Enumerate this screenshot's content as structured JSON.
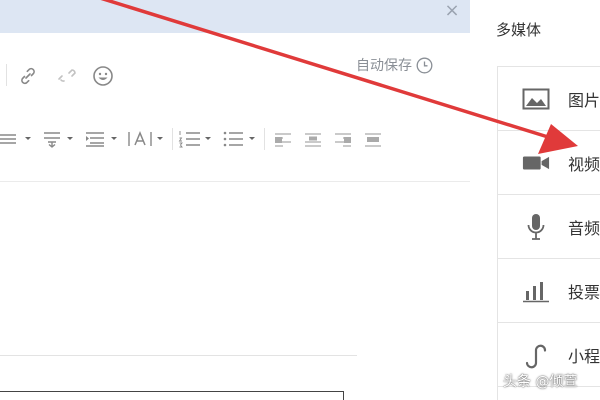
{
  "editor": {
    "autosave_label": "自动保存",
    "icons": [
      "link-icon",
      "unlink-icon",
      "emoji-icon",
      "line-height-icon",
      "paragraph-spacing-icon",
      "indent-icon",
      "font-size-icon",
      "ordered-list-icon",
      "unordered-list-icon",
      "align-left-icon",
      "align-center-icon",
      "align-right-icon",
      "align-justify-icon"
    ]
  },
  "panel": {
    "title": "多媒体",
    "items": [
      {
        "label": "图片",
        "icon": "image-icon"
      },
      {
        "label": "视频",
        "icon": "video-icon"
      },
      {
        "label": "音频",
        "icon": "microphone-icon"
      },
      {
        "label": "投票",
        "icon": "poll-icon"
      },
      {
        "label": "小程",
        "icon": "mini-program-icon"
      }
    ]
  },
  "annotation": {
    "arrow_color": "#e03a3a"
  },
  "colors": {
    "notice_bar": "#dde6f3",
    "icon_gray": "#888888"
  },
  "watermark": "头条 @倾萱"
}
